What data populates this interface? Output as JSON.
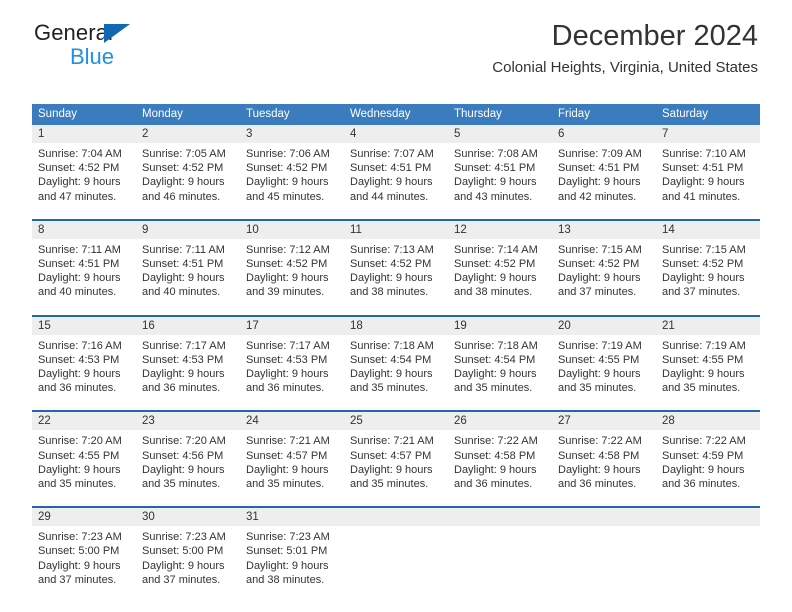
{
  "brand": {
    "name_part1": "General",
    "name_part2": "Blue",
    "logo_icon": "triangle-logo-icon"
  },
  "header": {
    "title": "December 2024",
    "location": "Colonial Heights, Virginia, United States"
  },
  "colors": {
    "header_blue": "#3a7cbe",
    "week_rule_blue": "#1d69ab",
    "daynum_band": "#eeeeee",
    "brand_blue_dark": "#1268b3",
    "brand_blue_light": "#1f91e0",
    "text": "#333333"
  },
  "weekdays": [
    "Sunday",
    "Monday",
    "Tuesday",
    "Wednesday",
    "Thursday",
    "Friday",
    "Saturday"
  ],
  "weeks": [
    {
      "days": [
        {
          "date": "1",
          "lines": [
            "Sunrise: 7:04 AM",
            "Sunset: 4:52 PM",
            "Daylight: 9 hours",
            "and 47 minutes."
          ]
        },
        {
          "date": "2",
          "lines": [
            "Sunrise: 7:05 AM",
            "Sunset: 4:52 PM",
            "Daylight: 9 hours",
            "and 46 minutes."
          ]
        },
        {
          "date": "3",
          "lines": [
            "Sunrise: 7:06 AM",
            "Sunset: 4:52 PM",
            "Daylight: 9 hours",
            "and 45 minutes."
          ]
        },
        {
          "date": "4",
          "lines": [
            "Sunrise: 7:07 AM",
            "Sunset: 4:51 PM",
            "Daylight: 9 hours",
            "and 44 minutes."
          ]
        },
        {
          "date": "5",
          "lines": [
            "Sunrise: 7:08 AM",
            "Sunset: 4:51 PM",
            "Daylight: 9 hours",
            "and 43 minutes."
          ]
        },
        {
          "date": "6",
          "lines": [
            "Sunrise: 7:09 AM",
            "Sunset: 4:51 PM",
            "Daylight: 9 hours",
            "and 42 minutes."
          ]
        },
        {
          "date": "7",
          "lines": [
            "Sunrise: 7:10 AM",
            "Sunset: 4:51 PM",
            "Daylight: 9 hours",
            "and 41 minutes."
          ]
        }
      ]
    },
    {
      "days": [
        {
          "date": "8",
          "lines": [
            "Sunrise: 7:11 AM",
            "Sunset: 4:51 PM",
            "Daylight: 9 hours",
            "and 40 minutes."
          ]
        },
        {
          "date": "9",
          "lines": [
            "Sunrise: 7:11 AM",
            "Sunset: 4:51 PM",
            "Daylight: 9 hours",
            "and 40 minutes."
          ]
        },
        {
          "date": "10",
          "lines": [
            "Sunrise: 7:12 AM",
            "Sunset: 4:52 PM",
            "Daylight: 9 hours",
            "and 39 minutes."
          ]
        },
        {
          "date": "11",
          "lines": [
            "Sunrise: 7:13 AM",
            "Sunset: 4:52 PM",
            "Daylight: 9 hours",
            "and 38 minutes."
          ]
        },
        {
          "date": "12",
          "lines": [
            "Sunrise: 7:14 AM",
            "Sunset: 4:52 PM",
            "Daylight: 9 hours",
            "and 38 minutes."
          ]
        },
        {
          "date": "13",
          "lines": [
            "Sunrise: 7:15 AM",
            "Sunset: 4:52 PM",
            "Daylight: 9 hours",
            "and 37 minutes."
          ]
        },
        {
          "date": "14",
          "lines": [
            "Sunrise: 7:15 AM",
            "Sunset: 4:52 PM",
            "Daylight: 9 hours",
            "and 37 minutes."
          ]
        }
      ]
    },
    {
      "days": [
        {
          "date": "15",
          "lines": [
            "Sunrise: 7:16 AM",
            "Sunset: 4:53 PM",
            "Daylight: 9 hours",
            "and 36 minutes."
          ]
        },
        {
          "date": "16",
          "lines": [
            "Sunrise: 7:17 AM",
            "Sunset: 4:53 PM",
            "Daylight: 9 hours",
            "and 36 minutes."
          ]
        },
        {
          "date": "17",
          "lines": [
            "Sunrise: 7:17 AM",
            "Sunset: 4:53 PM",
            "Daylight: 9 hours",
            "and 36 minutes."
          ]
        },
        {
          "date": "18",
          "lines": [
            "Sunrise: 7:18 AM",
            "Sunset: 4:54 PM",
            "Daylight: 9 hours",
            "and 35 minutes."
          ]
        },
        {
          "date": "19",
          "lines": [
            "Sunrise: 7:18 AM",
            "Sunset: 4:54 PM",
            "Daylight: 9 hours",
            "and 35 minutes."
          ]
        },
        {
          "date": "20",
          "lines": [
            "Sunrise: 7:19 AM",
            "Sunset: 4:55 PM",
            "Daylight: 9 hours",
            "and 35 minutes."
          ]
        },
        {
          "date": "21",
          "lines": [
            "Sunrise: 7:19 AM",
            "Sunset: 4:55 PM",
            "Daylight: 9 hours",
            "and 35 minutes."
          ]
        }
      ]
    },
    {
      "days": [
        {
          "date": "22",
          "lines": [
            "Sunrise: 7:20 AM",
            "Sunset: 4:55 PM",
            "Daylight: 9 hours",
            "and 35 minutes."
          ]
        },
        {
          "date": "23",
          "lines": [
            "Sunrise: 7:20 AM",
            "Sunset: 4:56 PM",
            "Daylight: 9 hours",
            "and 35 minutes."
          ]
        },
        {
          "date": "24",
          "lines": [
            "Sunrise: 7:21 AM",
            "Sunset: 4:57 PM",
            "Daylight: 9 hours",
            "and 35 minutes."
          ]
        },
        {
          "date": "25",
          "lines": [
            "Sunrise: 7:21 AM",
            "Sunset: 4:57 PM",
            "Daylight: 9 hours",
            "and 35 minutes."
          ]
        },
        {
          "date": "26",
          "lines": [
            "Sunrise: 7:22 AM",
            "Sunset: 4:58 PM",
            "Daylight: 9 hours",
            "and 36 minutes."
          ]
        },
        {
          "date": "27",
          "lines": [
            "Sunrise: 7:22 AM",
            "Sunset: 4:58 PM",
            "Daylight: 9 hours",
            "and 36 minutes."
          ]
        },
        {
          "date": "28",
          "lines": [
            "Sunrise: 7:22 AM",
            "Sunset: 4:59 PM",
            "Daylight: 9 hours",
            "and 36 minutes."
          ]
        }
      ]
    },
    {
      "days": [
        {
          "date": "29",
          "lines": [
            "Sunrise: 7:23 AM",
            "Sunset: 5:00 PM",
            "Daylight: 9 hours",
            "and 37 minutes."
          ]
        },
        {
          "date": "30",
          "lines": [
            "Sunrise: 7:23 AM",
            "Sunset: 5:00 PM",
            "Daylight: 9 hours",
            "and 37 minutes."
          ]
        },
        {
          "date": "31",
          "lines": [
            "Sunrise: 7:23 AM",
            "Sunset: 5:01 PM",
            "Daylight: 9 hours",
            "and 38 minutes."
          ]
        },
        {
          "date": "",
          "lines": []
        },
        {
          "date": "",
          "lines": []
        },
        {
          "date": "",
          "lines": []
        },
        {
          "date": "",
          "lines": []
        }
      ]
    }
  ]
}
